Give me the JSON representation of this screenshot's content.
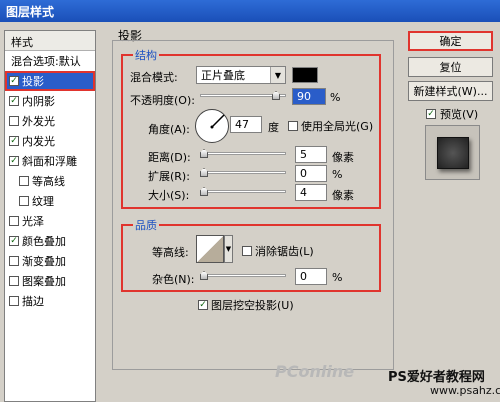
{
  "window": {
    "title": "图层样式"
  },
  "sidebar": {
    "header": "样式",
    "blend_item": "混合选项:默认",
    "items": [
      {
        "label": "投影",
        "checked": true,
        "selected": true
      },
      {
        "label": "内阴影",
        "checked": true
      },
      {
        "label": "外发光",
        "checked": false
      },
      {
        "label": "内发光",
        "checked": true
      },
      {
        "label": "斜面和浮雕",
        "checked": true
      },
      {
        "label": "等高线",
        "checked": false
      },
      {
        "label": "纹理",
        "checked": false
      },
      {
        "label": "光泽",
        "checked": false
      },
      {
        "label": "颜色叠加",
        "checked": true
      },
      {
        "label": "渐变叠加",
        "checked": false
      },
      {
        "label": "图案叠加",
        "checked": false
      },
      {
        "label": "描边",
        "checked": false
      }
    ]
  },
  "panel": {
    "title": "投影",
    "structure": {
      "legend": "结构",
      "blend_mode_label": "混合模式:",
      "blend_mode_value": "正片叠底",
      "shadow_color": "#000000",
      "opacity_label": "不透明度(O):",
      "opacity_value": "90",
      "opacity_fraction": 0.9,
      "opacity_unit": "%",
      "angle_label": "角度(A):",
      "angle_value": "47",
      "angle_unit": "度",
      "global_light_label": "使用全局光(G)",
      "global_light_checked": false,
      "distance_label": "距离(D):",
      "distance_value": "5",
      "distance_unit": "像素",
      "spread_label": "扩展(R):",
      "spread_value": "0",
      "spread_unit": "%",
      "size_label": "大小(S):",
      "size_value": "4",
      "size_unit": "像素"
    },
    "quality": {
      "legend": "品质",
      "contour_label": "等高线:",
      "antialias_label": "消除锯齿(L)",
      "antialias_checked": false,
      "noise_label": "杂色(N):",
      "noise_value": "0",
      "noise_unit": "%"
    },
    "knockout_label": "图层挖空投影(U)",
    "knockout_checked": true
  },
  "buttons": {
    "ok": "确定",
    "reset": "复位",
    "new_style": "新建样式(W)...",
    "preview_label": "预览(V)",
    "preview_checked": true
  },
  "watermark": {
    "pconline": "PConline",
    "site_cn": "PS爱好者教程网",
    "site_url": "www.psahz.com"
  }
}
